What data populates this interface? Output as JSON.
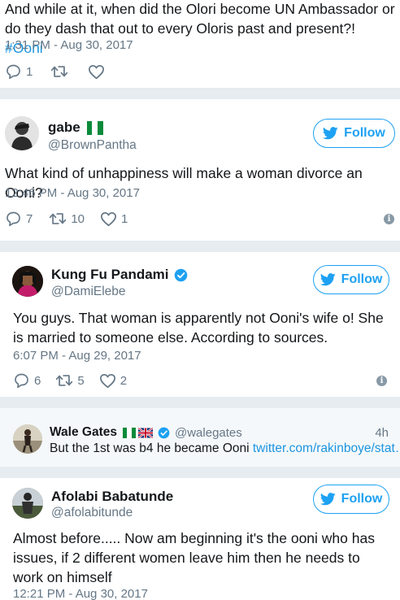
{
  "tweet1": {
    "text_a": "And while at it, when did the Olori become UN Ambassador or do they dash that out to every Oloris past and present?! ",
    "hashtag": "#Ooni",
    "timestamp": "1:31 PM - Aug 30, 2017",
    "replies": "1"
  },
  "tweet2": {
    "name": "gabe",
    "handle": "@BrownPantha",
    "follow_label": "Follow",
    "text": "What kind of unhappiness will make a woman divorce an Ooni?",
    "timestamp": "12:46 PM - Aug 30, 2017",
    "replies": "7",
    "retweets": "10",
    "likes": "1"
  },
  "tweet3": {
    "name": "Kung Fu Pandami",
    "handle": "@DamiElebe",
    "follow_label": "Follow",
    "text": "You guys. That woman is apparently not Ooni's wife o! She is married to someone else. According to sources.",
    "timestamp": "6:07 PM - Aug 29, 2017",
    "replies": "6",
    "retweets": "5",
    "likes": "2"
  },
  "reply": {
    "name": "Wale Gates",
    "handle": "@walegates",
    "time": "4h",
    "text": "But the 1st was b4 he became Ooni ",
    "link": "twitter.com/rakinboye/stat…"
  },
  "tweet4": {
    "name": "Afolabi Babatunde",
    "handle": "@afolabitunde",
    "follow_label": "Follow",
    "text": "Almost before..... Now am beginning it's the ooni who has issues, if 2 different women leave him then he needs to work on himself",
    "timestamp": "12:21 PM - Aug 30, 2017"
  },
  "colors": {
    "accent": "#1da1f2",
    "link": "#1b95e0",
    "muted": "#657786",
    "separator": "#e6ecf0"
  },
  "icons": [
    "reply-icon",
    "retweet-icon",
    "like-icon",
    "info-icon",
    "twitter-bird-icon",
    "verified-badge-icon",
    "nigeria-flag-icon",
    "uk-flag-icon"
  ]
}
